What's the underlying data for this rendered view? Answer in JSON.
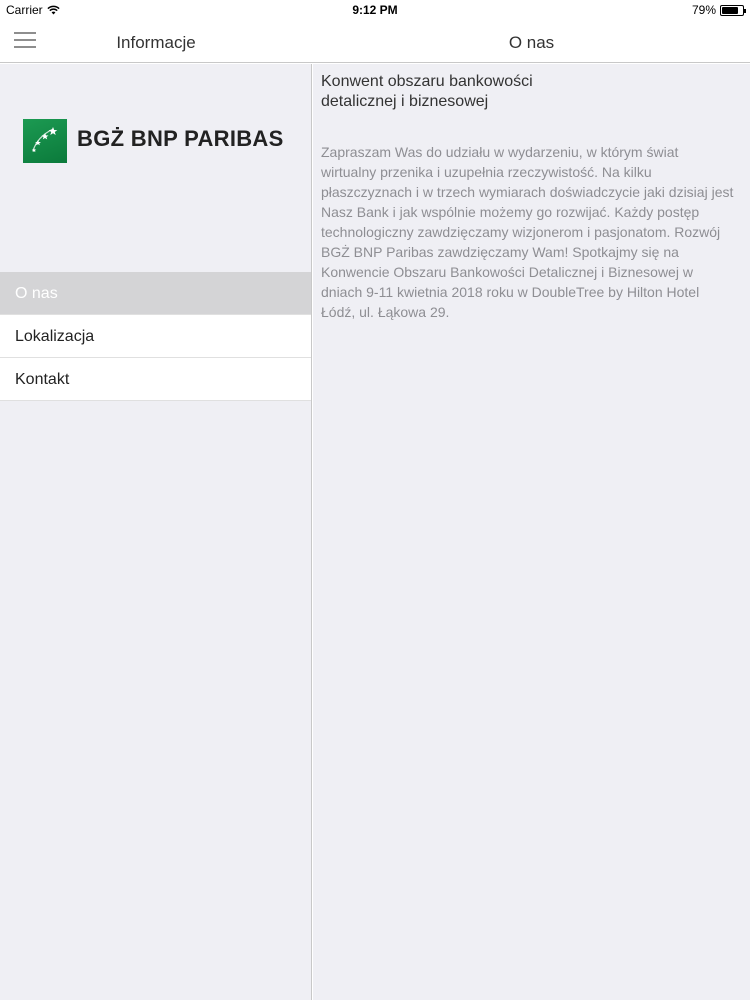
{
  "status": {
    "carrier": "Carrier",
    "time": "9:12 PM",
    "battery": "79%",
    "battery_level": 0.79
  },
  "nav": {
    "left_title": "Informacje",
    "right_title": "O nas",
    "menu_icon": "hamburger-icon"
  },
  "sidebar": {
    "logo_text": "BGŻ BNP PARIBAS",
    "logo_icon": "bnp-stars-icon",
    "items": [
      {
        "label": "O nas",
        "active": true
      },
      {
        "label": "Lokalizacja",
        "active": false
      },
      {
        "label": "Kontakt",
        "active": false
      }
    ]
  },
  "content": {
    "heading": "Konwent obszaru bankowości detalicznej i biznesowej",
    "body": "Zapraszam Was do udziału w wydarzeniu, w którym świat wirtualny przenika i uzupełnia rzeczywistość. Na kilku płaszczyznach i w trzech wymiarach doświadczycie jaki dzisiaj jest Nasz Bank i jak wspólnie możemy  go rozwijać. Każdy postęp technologiczny zawdzięczamy wizjonerom i pasjonatom. Rozwój BGŻ BNP Paribas zawdzięczamy Wam! Spotkajmy się na Konwencie Obszaru Bankowości Detalicznej i Biznesowej w dniach 9-11 kwietnia 2018 roku w DoubleTree by Hilton Hotel Łódź, ul. Łąkowa 29."
  },
  "colors": {
    "brand_green": "#0b7a3b",
    "active_item_bg": "#d4d4d6",
    "background": "#efeff4"
  }
}
